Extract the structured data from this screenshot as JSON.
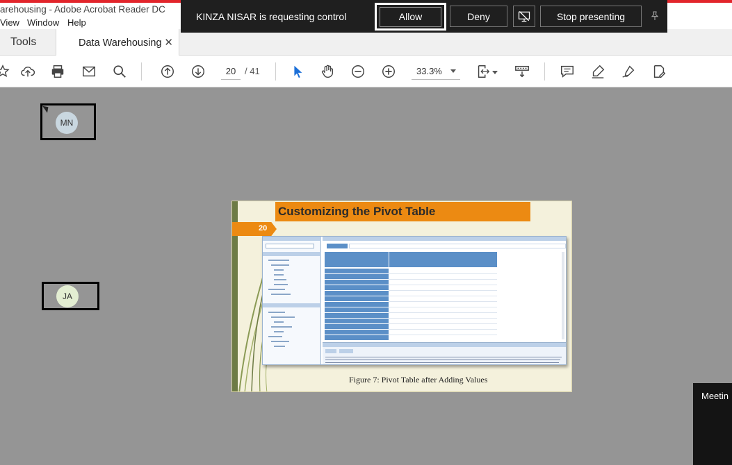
{
  "app": {
    "window_title": "arehousing - Adobe Acrobat Reader DC",
    "menu": [
      "View",
      "Window",
      "Help"
    ]
  },
  "tabs": {
    "tools": "Tools",
    "document": "Data Warehousing"
  },
  "toolbar": {
    "current_page": "20",
    "total_pages": "/ 41",
    "zoom": "33.3%"
  },
  "control_request": {
    "message": "KINZA NISAR is requesting control",
    "allow_label": "Allow",
    "deny_label": "Deny",
    "stop_label": "Stop presenting"
  },
  "participants": [
    {
      "initials": "MN",
      "color": "#c9d7e0"
    },
    {
      "initials": "JA",
      "color": "#e3eed2"
    }
  ],
  "slide": {
    "title": "Customizing the Pivot Table",
    "number": "20",
    "caption": "Figure 7: Pivot Table after Adding Values"
  },
  "meeting_panel": {
    "label": "Meetin"
  },
  "colors": {
    "accent_red": "#e2252b",
    "slide_orange": "#ec8a12",
    "control_bar": "#1f1f1f"
  }
}
